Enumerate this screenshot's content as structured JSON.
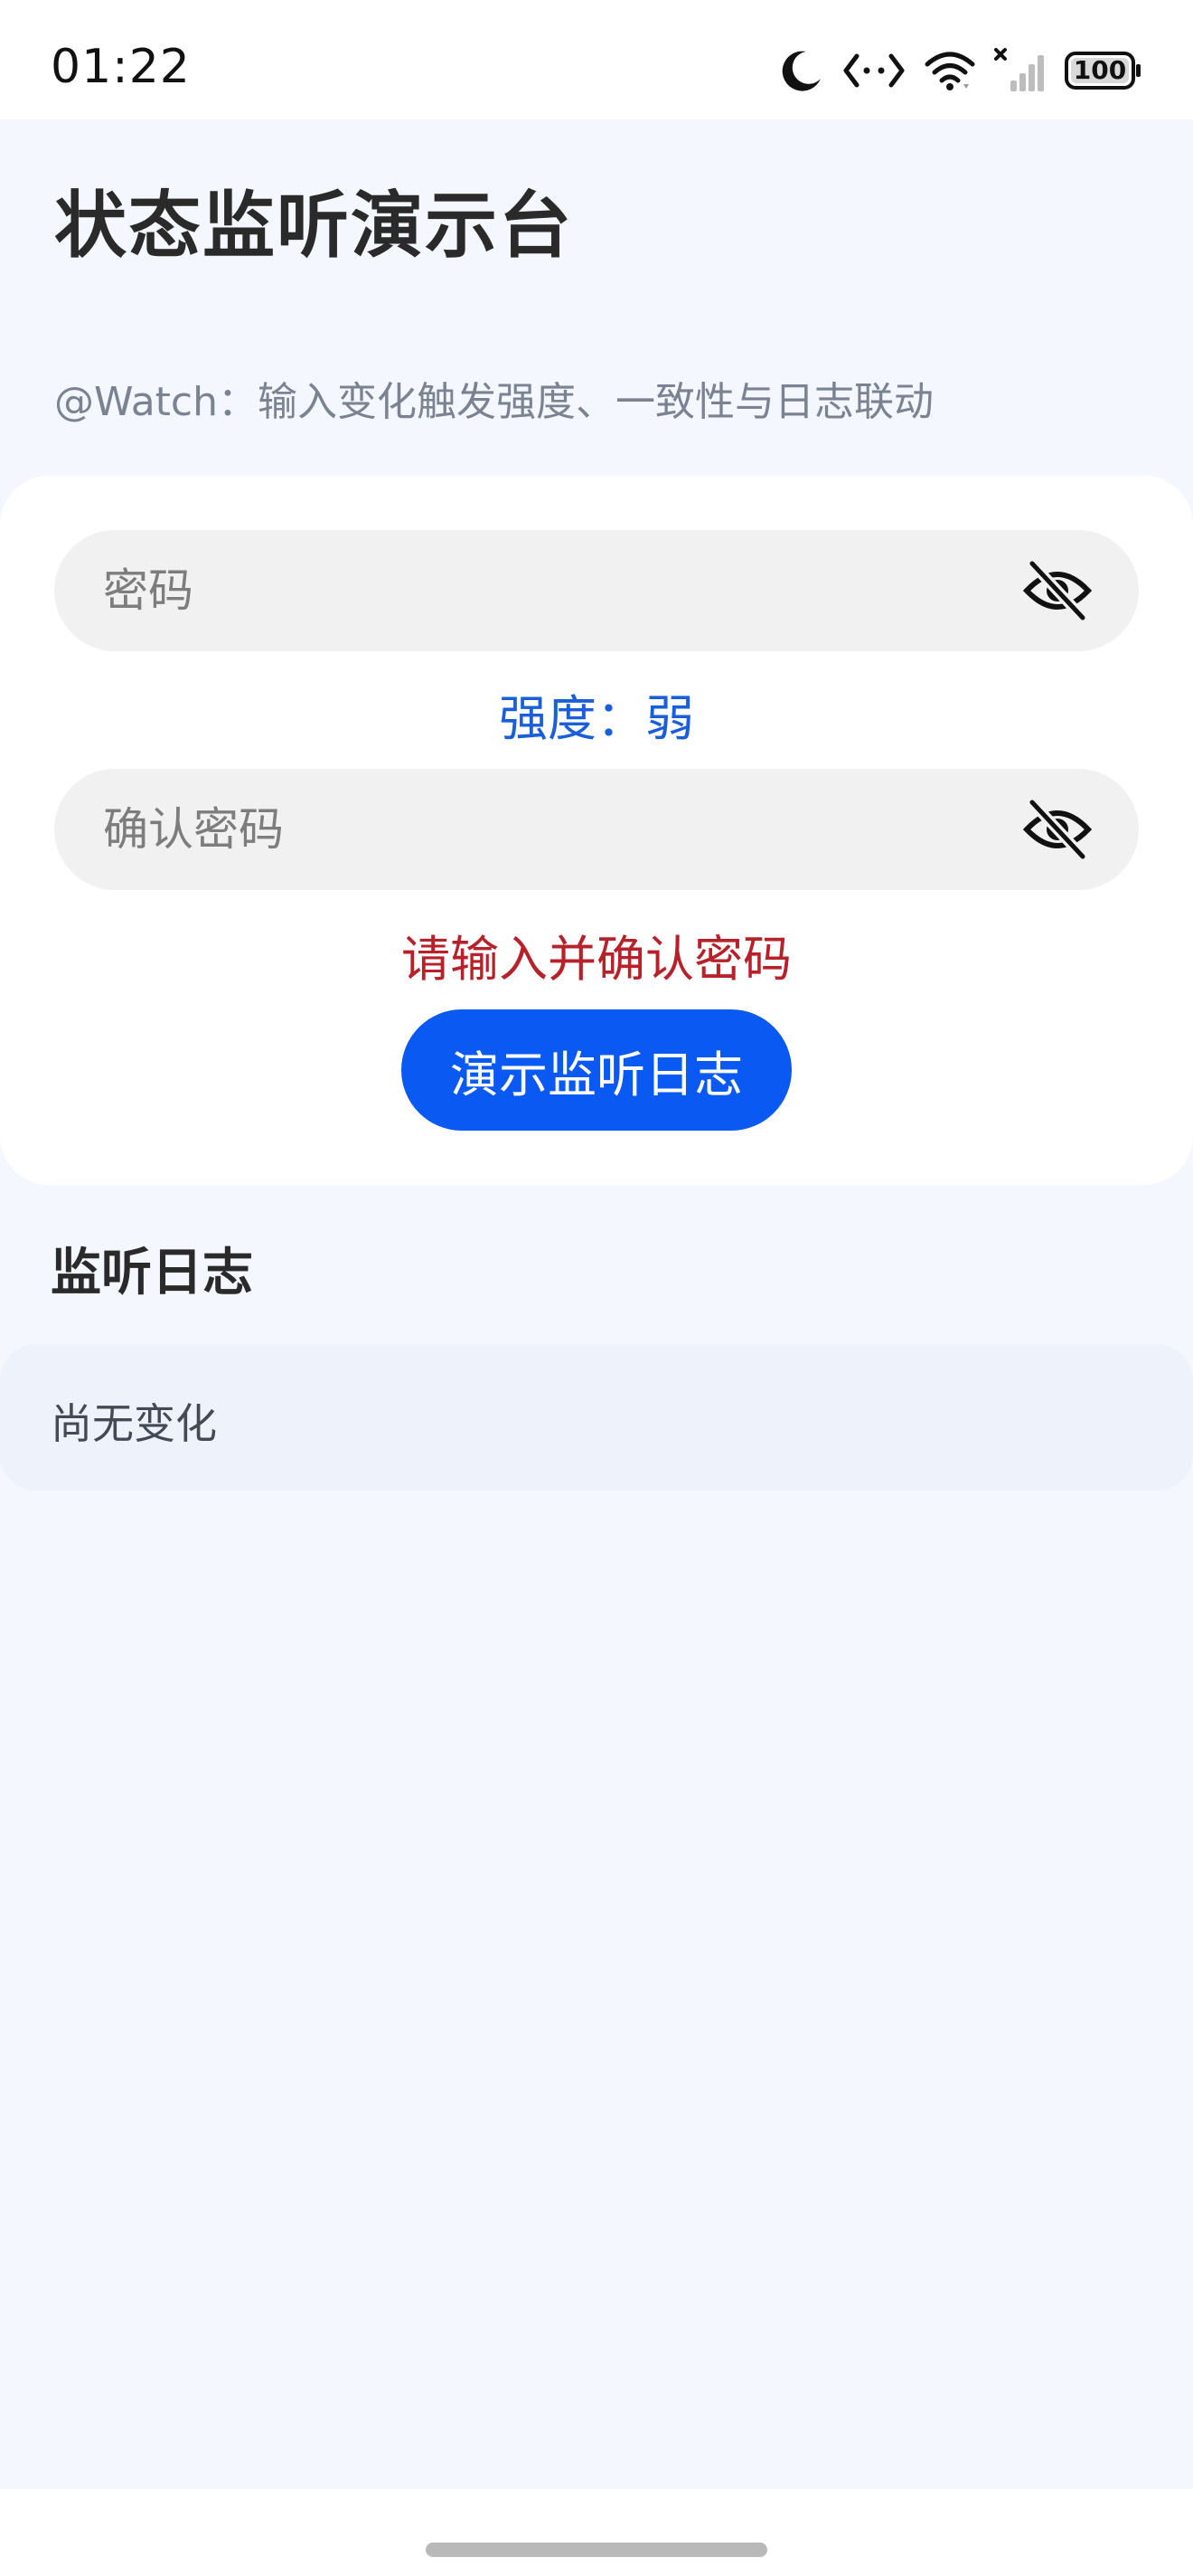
{
  "status_bar": {
    "time": "01:22",
    "battery": "100",
    "icons": [
      "moon-icon",
      "data-transfer-icon",
      "wifi-icon",
      "cellular-signal-icon",
      "battery-icon"
    ]
  },
  "header": {
    "title": "状态监听演示台",
    "subtitle": "@Watch：输入变化触发强度、一致性与日志联动"
  },
  "form": {
    "password_placeholder": "密码",
    "password_value": "",
    "confirm_placeholder": "确认密码",
    "confirm_value": "",
    "visibility_icon": "eye-off-icon",
    "strength_text": "强度：弱",
    "mismatch_text": "请输入并确认密码",
    "demo_button_label": "演示监听日志"
  },
  "log": {
    "heading": "监听日志",
    "empty_text": "尚无变化"
  },
  "colors": {
    "background": "#f4f7fd",
    "accent": "#0a59f2",
    "strength": "#1a5fd9",
    "error": "#b6212a"
  }
}
